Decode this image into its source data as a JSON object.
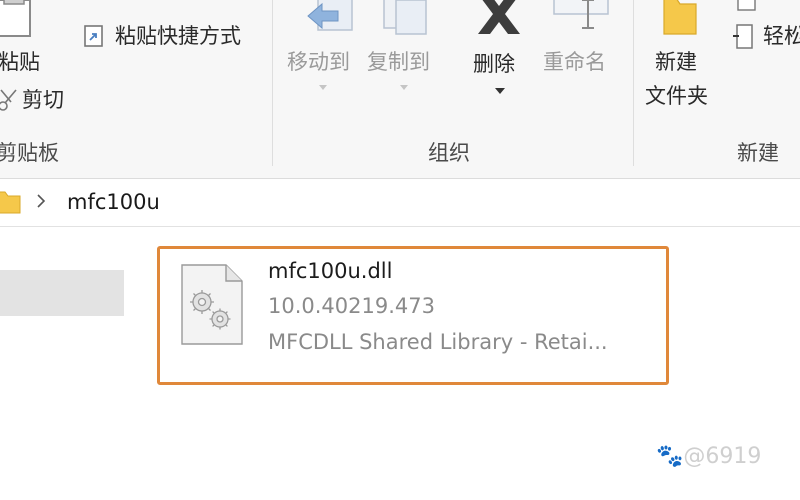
{
  "ribbon": {
    "clipboard": {
      "paste_label": "粘贴",
      "paste_shortcut_label": "粘贴快捷方式",
      "cut_label": "剪切",
      "group_label": "剪贴板"
    },
    "organize": {
      "move_to_label": "移动到",
      "copy_to_label": "复制到",
      "delete_label": "删除",
      "rename_label": "重命名",
      "group_label": "组织"
    },
    "new": {
      "new_folder_label_line1": "新建",
      "new_folder_label_line2": "文件夹",
      "easy_access_label": "轻松",
      "group_label": "新建"
    }
  },
  "address": {
    "current_folder": "mfc100u"
  },
  "file": {
    "name": "mfc100u.dll",
    "version": "10.0.40219.473",
    "description": "MFCDLL Shared Library - Retai..."
  },
  "watermark": {
    "text": "@6919"
  },
  "colors": {
    "highlight_border": "#e0883a",
    "folder_yellow": "#f5c84a"
  }
}
